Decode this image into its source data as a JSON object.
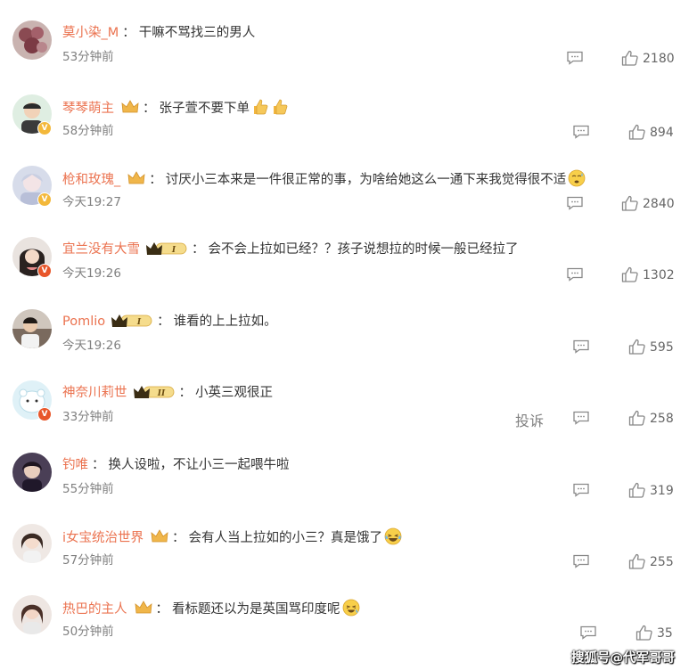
{
  "comments": [
    {
      "user": "莫小染_M",
      "text": "干嘛不骂找三的男人",
      "time": "53分钟前",
      "likes": "2180"
    },
    {
      "user": "琴琴萌主",
      "text": "张子萱不要下单",
      "time": "58分钟前",
      "likes": "894"
    },
    {
      "user": "枪和玫瑰_",
      "text": "讨厌小三本来是一件很正常的事，为啥给她这么一通下来我觉得很不适",
      "time": "今天19:27",
      "likes": "2840"
    },
    {
      "user": "宜兰没有大雪",
      "text": "会不会上拉如已经？？孩子说想拉的时候一般已经拉了",
      "time": "今天19:26",
      "likes": "1302"
    },
    {
      "user": "Pomlio",
      "text": "谁看的上上拉如。",
      "time": "今天19:26",
      "likes": "595"
    },
    {
      "user": "神奈川莉世",
      "text": "小英三观很正",
      "time": "33分钟前",
      "likes": "258",
      "report": "投诉"
    },
    {
      "user": "钓唯",
      "text": "换人设啦，不让小三一起喂牛啦",
      "time": "55分钟前",
      "likes": "319"
    },
    {
      "user": "i女宝统治世界",
      "text": "会有人当上拉如的小三？真是饿了",
      "time": "57分钟前",
      "likes": "255"
    },
    {
      "user": "热巴的主人",
      "text": "看标题还以为是英国骂印度呢",
      "time": "50分钟前",
      "likes": "35"
    }
  ],
  "separator": "：",
  "badges": {
    "level1": "I",
    "level2": "II"
  },
  "watermark": "搜狐号@代军哥哥",
  "colors": {
    "username": "#eb7350",
    "time": "#808080",
    "text": "#333333"
  }
}
